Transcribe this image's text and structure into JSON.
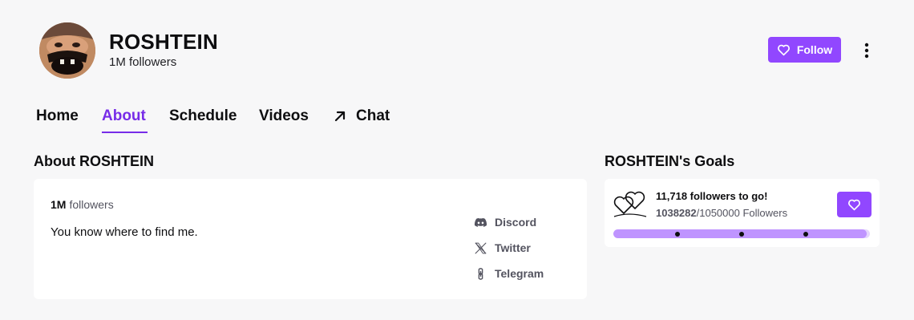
{
  "channel": {
    "name": "ROSHTEIN",
    "followers_label": "1M followers"
  },
  "header": {
    "follow_label": "Follow",
    "follow_icon": "heart-icon",
    "more_icon": "more-vertical-icon"
  },
  "tabs": [
    {
      "label": "Home",
      "active": false
    },
    {
      "label": "About",
      "active": true
    },
    {
      "label": "Schedule",
      "active": false
    },
    {
      "label": "Videos",
      "active": false
    },
    {
      "label": "Chat",
      "active": false,
      "icon": "arrow-up-right-icon"
    }
  ],
  "about": {
    "heading": "About ROSHTEIN",
    "count": "1M",
    "count_label": "followers",
    "bio": "You know where to find me.",
    "links": [
      {
        "label": "Discord",
        "icon": "discord-icon"
      },
      {
        "label": "Twitter",
        "icon": "x-twitter-icon"
      },
      {
        "label": "Telegram",
        "icon": "telegram-link-icon"
      }
    ]
  },
  "goals": {
    "heading": "ROSHTEIN's Goals",
    "title": "11,718 followers to go!",
    "current": "1038282",
    "target_text": "/1050000 Followers",
    "progress_fraction": 0.9888,
    "icon": "hearts-goal-icon",
    "follow_icon": "heart-icon"
  },
  "colors": {
    "accent": "#9147ff",
    "active_tab": "#772ce8",
    "progress_fill": "#bf94ff",
    "background": "#f7f7f8"
  }
}
